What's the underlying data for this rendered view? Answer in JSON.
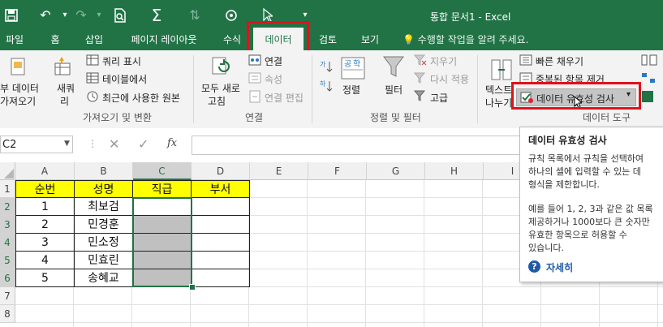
{
  "app": {
    "doc_title": "통합 문서1 - Excel"
  },
  "tabs": [
    {
      "label": "파일"
    },
    {
      "label": "홈"
    },
    {
      "label": "삽입"
    },
    {
      "label": "페이지 레이아웃"
    },
    {
      "label": "수식"
    },
    {
      "label": "데이터"
    },
    {
      "label": "검토"
    },
    {
      "label": "보기"
    }
  ],
  "active_tab": "데이터",
  "tell_me": "수행할 작업을 알려 주세요.",
  "ribbon": {
    "get_data_1": "부 데이터",
    "get_data_2": "가져오기",
    "new_query_1": "새쿼",
    "new_query_2": "리",
    "show_queries": "쿼리 표시",
    "from_table": "테이블에서",
    "recent_sources": "최근에 사용한 원본",
    "group_get_transform": "가져오기 및 변환",
    "refresh_all_1": "모두 새로",
    "refresh_all_2": "고침",
    "connections": "연결",
    "properties": "속성",
    "edit_links": "연결 편집",
    "group_connections": "연결",
    "sort": "정렬",
    "filter": "필터",
    "clear": "지우기",
    "reapply": "다시 적용",
    "advanced": "고급",
    "group_sort_filter": "정렬 및 필터",
    "text_to_columns_1": "텍스트",
    "text_to_columns_2": "나누기",
    "flash_fill": "빠른 채우기",
    "remove_duplicates": "중복된 항목 제거",
    "data_validation": "데이터 유효성 검사",
    "group_data_tools": "데이터 도구"
  },
  "name_box": "C2",
  "fx_label": "fx",
  "columns": [
    "A",
    "B",
    "C",
    "D",
    "E",
    "F",
    "G",
    "H",
    "I"
  ],
  "rows": [
    "1",
    "2",
    "3",
    "4",
    "5",
    "6",
    "7",
    "8"
  ],
  "table": {
    "headers": [
      "순번",
      "성명",
      "직급",
      "부서"
    ],
    "rows": [
      [
        "1",
        "최보검",
        "",
        ""
      ],
      [
        "2",
        "민경훈",
        "",
        ""
      ],
      [
        "3",
        "민소정",
        "",
        ""
      ],
      [
        "4",
        "민효린",
        "",
        ""
      ],
      [
        "5",
        "송혜교",
        "",
        ""
      ]
    ]
  },
  "tooltip": {
    "title": "데이터 유효성 검사",
    "lines": [
      "규칙 목록에서 규칙을 선택하여",
      "하나의 셀에 입력할 수 있는 데",
      "형식을 제한합니다.",
      "",
      "예를 들어 1, 2, 3과 같은 값 목록",
      "제공하거나 1000보다 큰 숫자만",
      "유효한 항목으로 허용할 수",
      "있습니다."
    ],
    "more": "자세히"
  },
  "colors": {
    "excel_green": "#217346",
    "highlight_red": "#e0121a",
    "header_yellow": "#ffff00",
    "gray_fill": "#c0c0c0"
  }
}
